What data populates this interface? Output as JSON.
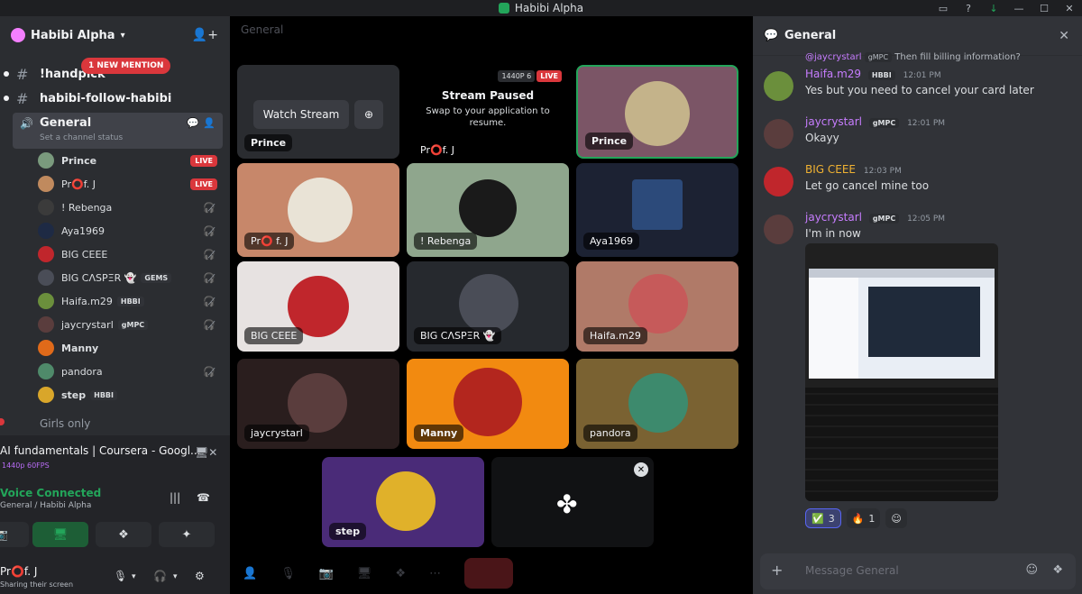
{
  "window": {
    "title": "Habibi Alpha"
  },
  "server": {
    "name": "Habibi Alpha"
  },
  "channels": {
    "ch1": "!handpick",
    "mention": "1 NEW MENTION",
    "ch2": "habibi-follow-habibi",
    "voice_name": "General",
    "voice_status": "Set a channel status",
    "girls": "Girls only"
  },
  "voice_users": [
    {
      "name": "Prince",
      "live": "LIVE"
    },
    {
      "name": "Pr⭕f. J",
      "live": "LIVE"
    },
    {
      "name": "! Rebenga"
    },
    {
      "name": "Aya1969"
    },
    {
      "name": "BIG CEEE"
    },
    {
      "name": "BIG CΛSPΞR 👻",
      "badge": "GEMS"
    },
    {
      "name": "Haifa.m29",
      "badge": "HBBI"
    },
    {
      "name": "jaycrystarl",
      "badge": "gMPC"
    },
    {
      "name": "Manny"
    },
    {
      "name": "pandora"
    },
    {
      "name": "step",
      "badge": "HBBI"
    }
  ],
  "stream_panel": {
    "title": "AI fundamentals | Coursera - Googl...",
    "quality": "1440p 60FPS",
    "voice_connected": "Voice Connected",
    "voice_sub": "General / Habibi Alpha"
  },
  "user": {
    "name": "Pr⭕f. J",
    "status": "Sharing their screen"
  },
  "stage": {
    "channel": "General",
    "watch_stream": "Watch Stream",
    "paused_title": "Stream Paused",
    "paused_sub": "Swap to your application to resume.",
    "res": "1440P 6",
    "live": "LIVE",
    "tiles": [
      "Prince",
      "Pr⭕f. J",
      "Prince",
      "Pr⭕ f. J",
      "! Rebenga",
      "Aya1969",
      "BIG CEEE",
      "BIG CΛSPΞR 👻",
      "Haifa.m29",
      "jaycrystarl",
      "Manny",
      "pandora",
      "step"
    ]
  },
  "chat": {
    "title": "General",
    "reply_user": "@jaycrystarl",
    "reply_badge": "gMPC",
    "reply_text": "Then fill billing information?",
    "messages": [
      {
        "name": "Haifa.m29",
        "badge": "HBBI",
        "time": "12:01 PM",
        "text": "Yes but you need to cancel your card later",
        "color": "#c77dff"
      },
      {
        "name": "jaycrystarl",
        "badge": "gMPC",
        "time": "12:01 PM",
        "text": "Okayy",
        "color": "#c77dff"
      },
      {
        "name": "BIG CEEE",
        "badge": "",
        "time": "12:03 PM",
        "text": "Let go cancel mine too",
        "color": "#f0b232"
      },
      {
        "name": "jaycrystarl",
        "badge": "gMPC",
        "time": "12:05 PM",
        "text": "I'm in now",
        "color": "#c77dff"
      }
    ],
    "reactions": [
      {
        "emoji": "✅",
        "count": "3"
      },
      {
        "emoji": "🔥",
        "count": "1"
      }
    ],
    "composer_placeholder": "Message General"
  },
  "colors": {
    "accent": "#5865f2",
    "live": "#da373c",
    "connected": "#23a55a"
  }
}
